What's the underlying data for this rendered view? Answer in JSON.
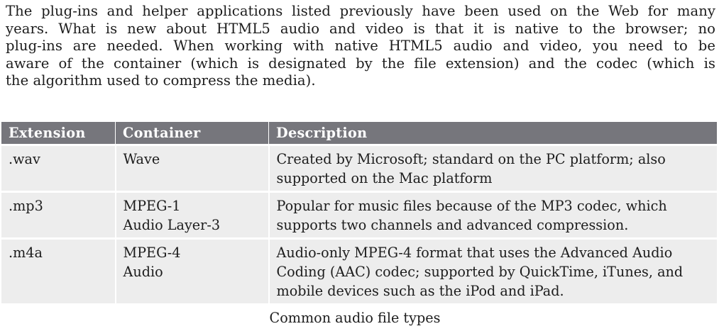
{
  "intro_lines": [
    "The plug-ins and helper applications listed previously have been used on the Web for many",
    "years. What is new about HTML5 audio and video is that it is native to the browser; no",
    "plug-ins are needed. When working with native HTML5 audio and video, you need to be",
    "aware of the container (which is designated by the file extension) and the codec (which is",
    "the algorithm used to compress the media)."
  ],
  "table": {
    "headers": [
      "Extension",
      "Container",
      "Description"
    ],
    "rows": [
      {
        "extension": ".wav",
        "container": [
          "Wave"
        ],
        "description": [
          "Created by Microsoft; standard on the PC platform; also",
          "supported on the Mac platform"
        ]
      },
      {
        "extension": ".mp3",
        "container": [
          "MPEG-1",
          "Audio Layer-3"
        ],
        "description": [
          "Popular for music files because of the MP3 codec, which",
          "supports two channels and advanced compression."
        ]
      },
      {
        "extension": ".m4a",
        "container": [
          "MPEG-4",
          "Audio"
        ],
        "description": [
          "Audio-only MPEG-4 format that uses the Advanced Audio",
          "Coding (AAC) codec; supported by QuickTime, iTunes, and",
          "mobile devices such as the iPod and iPad."
        ]
      }
    ]
  },
  "caption": "Common audio file types",
  "colors": {
    "header_bg": "#76767c",
    "header_text": "#ffffff",
    "cell_bg": "#ededed",
    "text": "#1c1c1c"
  }
}
